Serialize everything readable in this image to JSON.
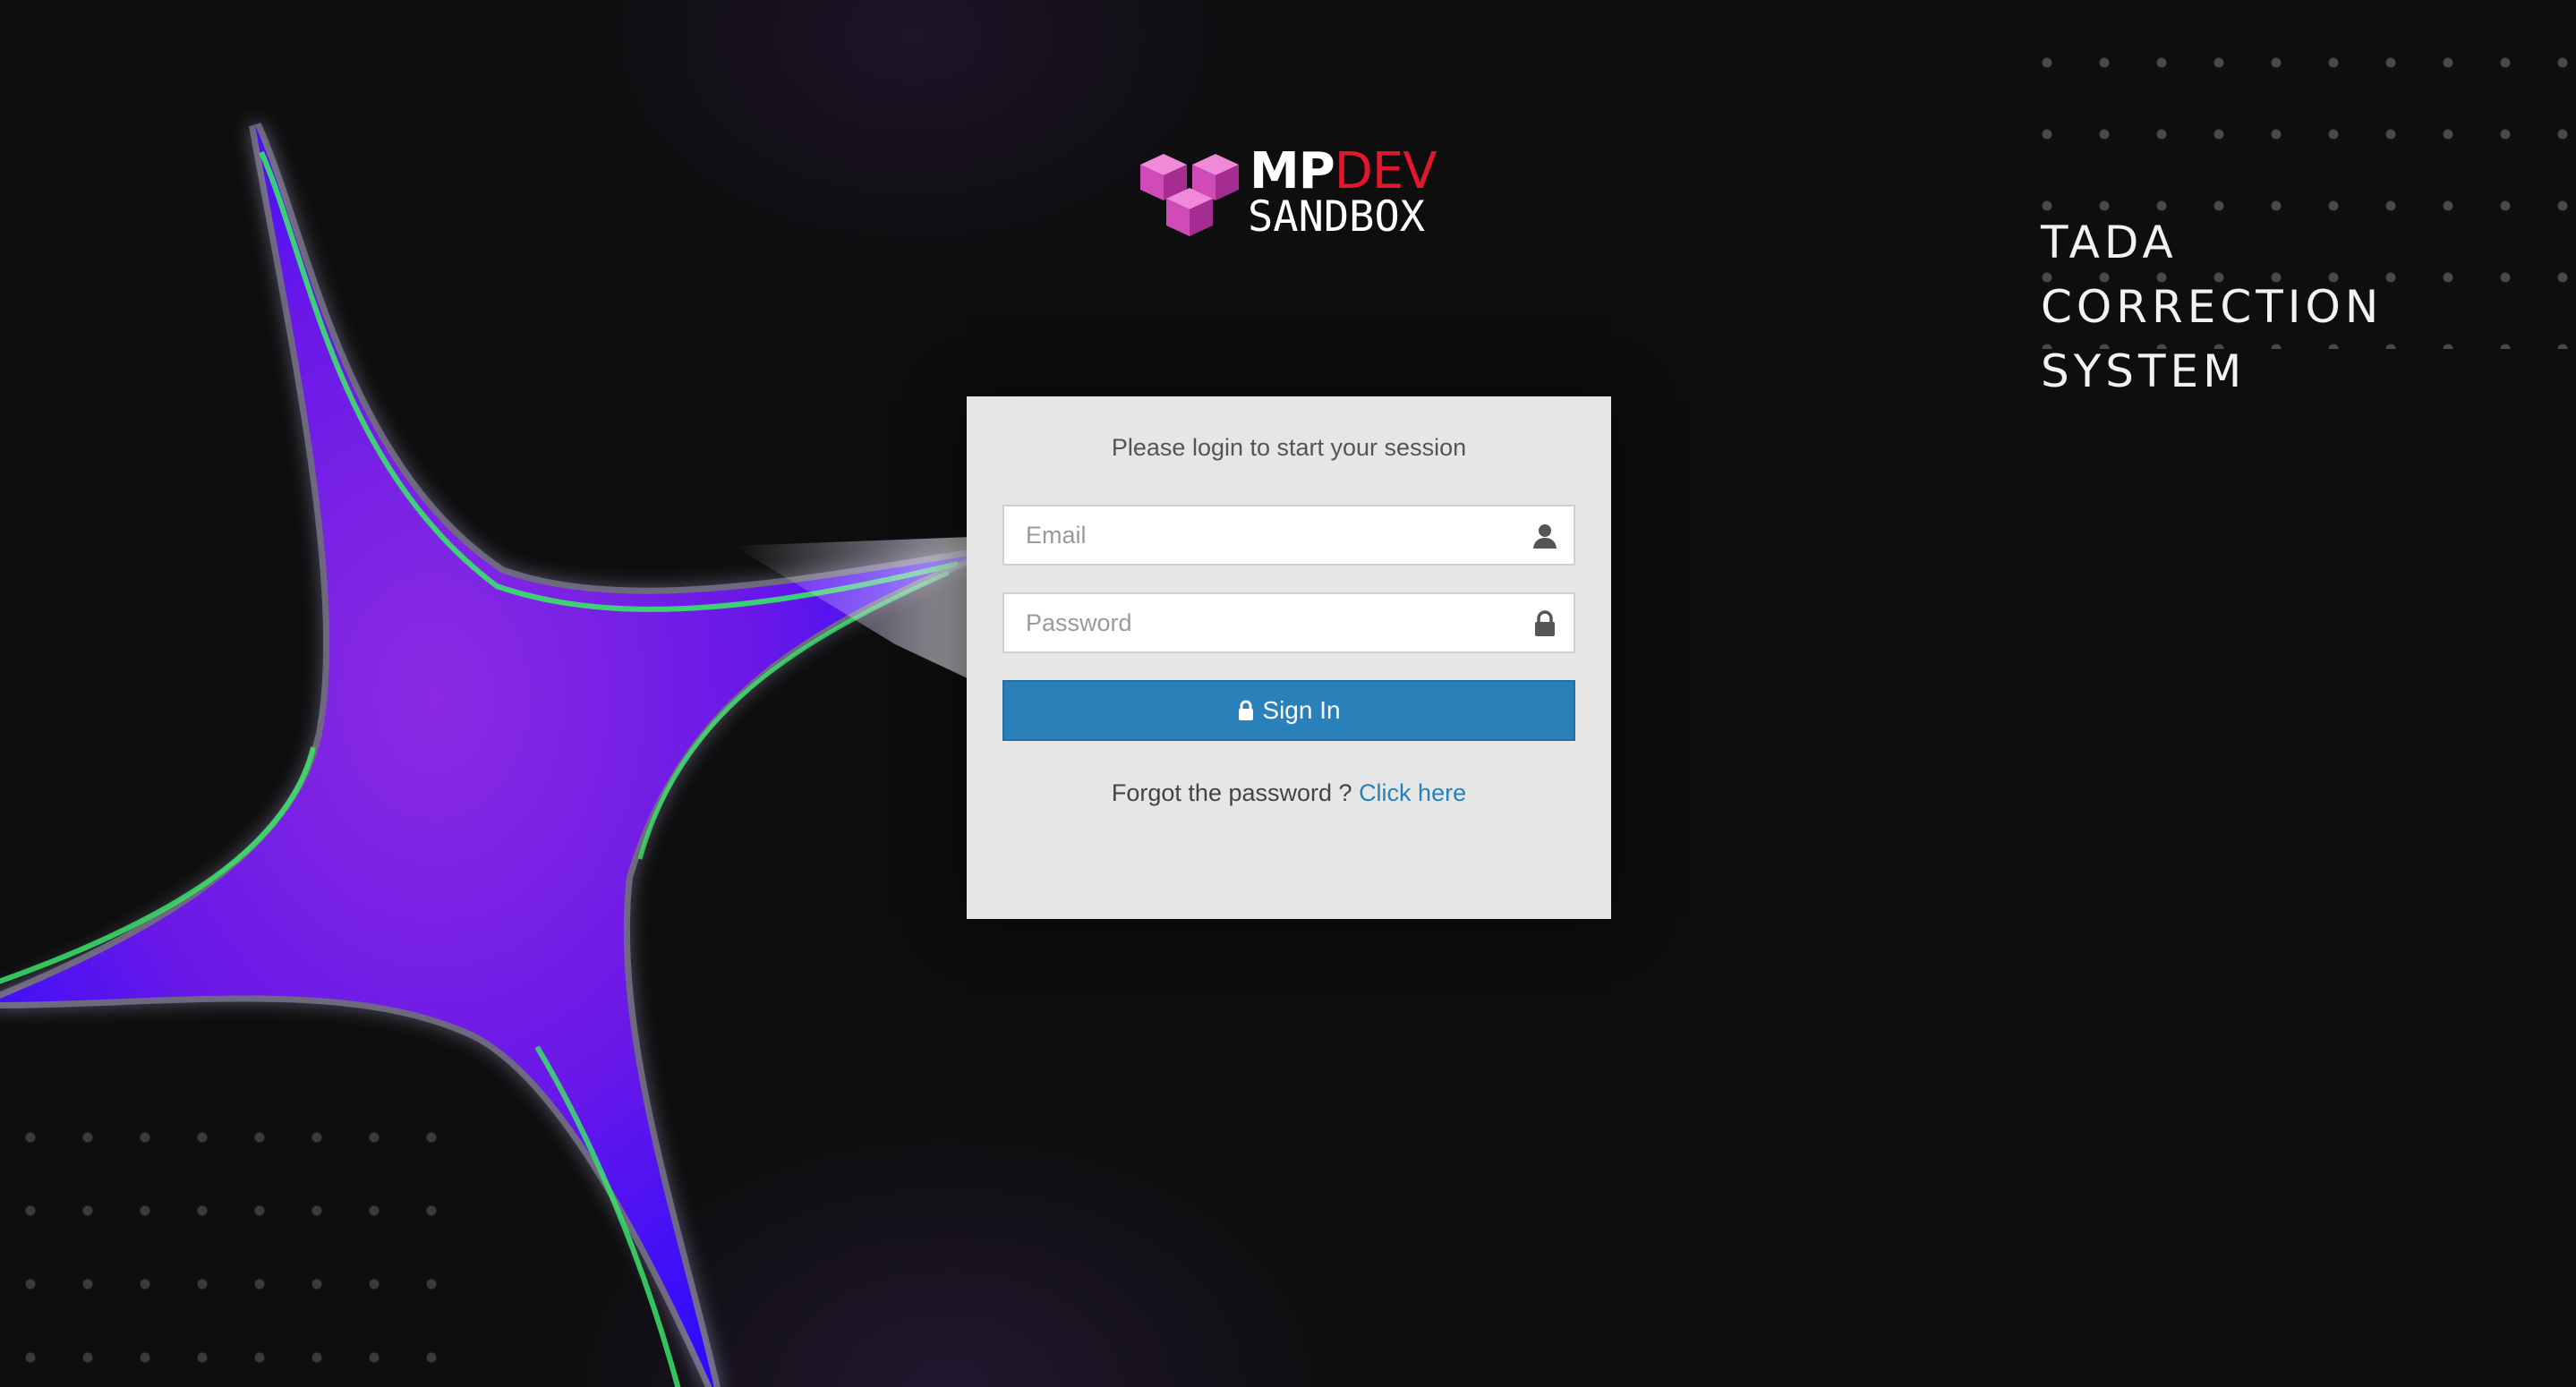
{
  "logo": {
    "word_mp": "MP",
    "word_dev": "DEV",
    "word_sandbox": "SANDBOX"
  },
  "system_title": {
    "lines": [
      "TADA",
      "CORRECTION",
      "SYSTEM"
    ]
  },
  "login": {
    "message": "Please login to start your session",
    "email_placeholder": "Email",
    "password_placeholder": "Password",
    "signin_label": "Sign In",
    "forgot_text": "Forgot the password ?",
    "forgot_link": "Click here"
  },
  "colors": {
    "background": "#0e0e0f",
    "card": "#e6e6e6",
    "primary": "#2a80b9",
    "logo_accent": "#e3172c",
    "cube": "#d04ab8"
  },
  "icons": {
    "email_field": "user-icon",
    "password_field": "lock-icon",
    "signin": "lock-icon"
  }
}
